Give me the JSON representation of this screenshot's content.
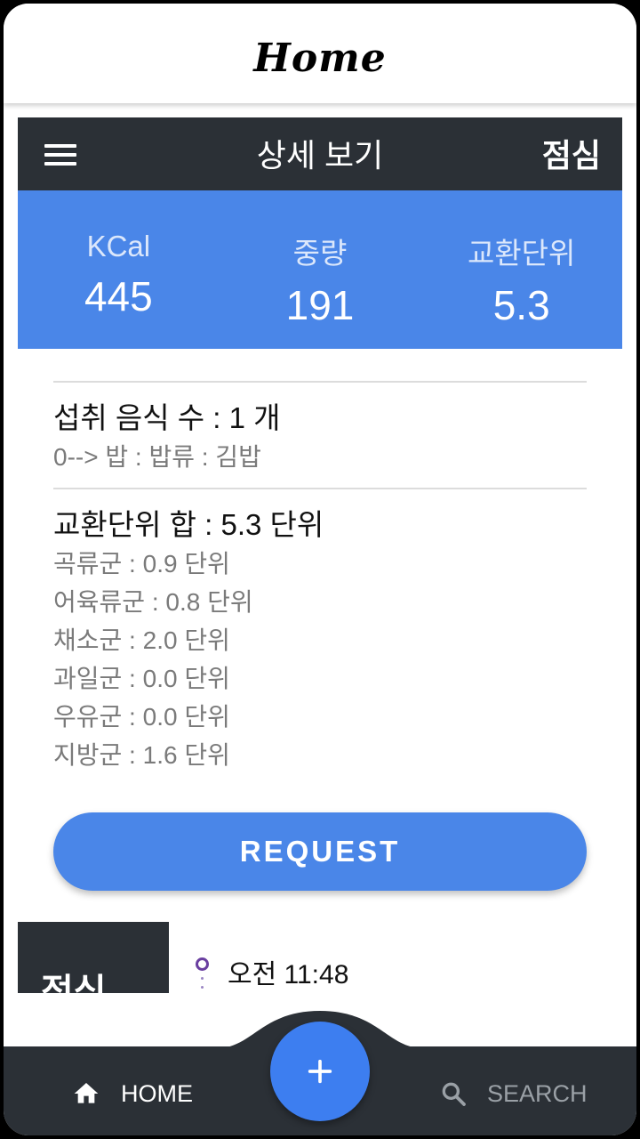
{
  "app_bar": {
    "title": "Home"
  },
  "detail": {
    "title": "상세 보기",
    "meal": "점심",
    "stats": [
      {
        "label": "KCal",
        "value": "445"
      },
      {
        "label": "중량",
        "value": "191"
      },
      {
        "label": "교환단위",
        "value": "5.3"
      }
    ]
  },
  "food": {
    "count_line": "섭취 음식 수 : 1 개",
    "items": [
      "0--> 밥 : 밥류 : 김밥"
    ]
  },
  "units": {
    "total_line": "교환단위 합 : 5.3 단위",
    "groups": [
      "곡류군 : 0.9 단위",
      "어육류군 : 0.8 단위",
      "채소군 : 2.0 단위",
      "과일군 : 0.0 단위",
      "우유군 : 0.0 단위",
      "지방군 : 1.6 단위"
    ]
  },
  "request_label": "REQUEST",
  "timeline": {
    "tile_label": "점심",
    "time": "오전 11:48"
  },
  "bottom_nav": {
    "home_label": "HOME",
    "search_label": "SEARCH"
  },
  "colors": {
    "accent": "#4a86e8",
    "dark": "#2b3036",
    "timeline": "#6a3fa0"
  },
  "icons": {
    "menu": "menu-icon",
    "home": "home-icon",
    "search": "search-icon",
    "fab": "plus-icon"
  }
}
